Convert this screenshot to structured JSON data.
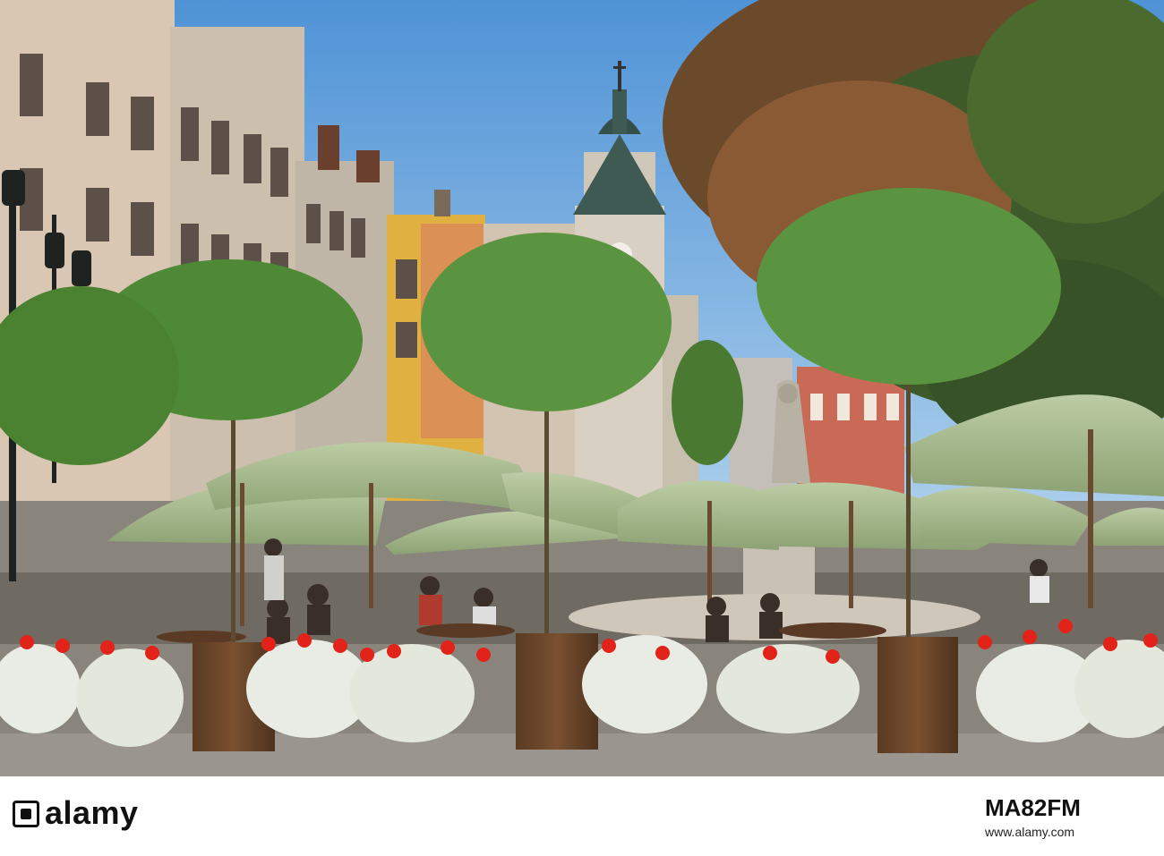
{
  "photo": {
    "sky_color": "#5fa4e0",
    "umbrella_color": "#a5b98a",
    "tree_color": "#3e6f2a",
    "flower_red": "#e2231a",
    "flower_white": "#e9ece4"
  },
  "stock": {
    "logo": "alamy",
    "image_id": "MA82FM",
    "url": "www.alamy.com"
  }
}
